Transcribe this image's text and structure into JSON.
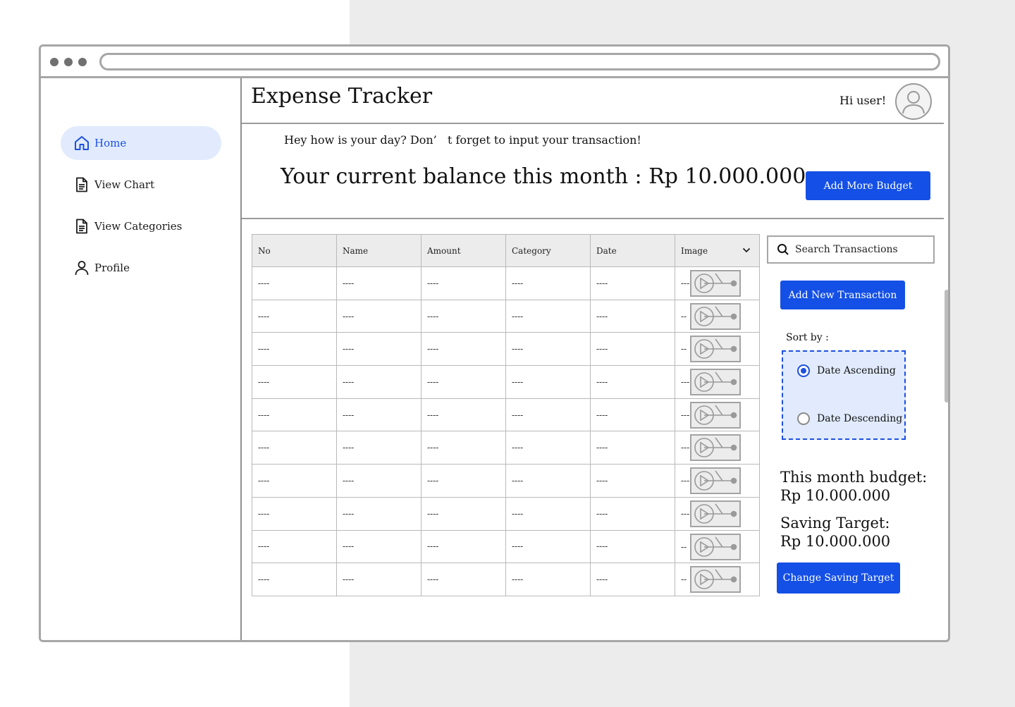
{
  "header": {
    "title": "Expense Tracker",
    "greeting": "Hi user!"
  },
  "sidebar": {
    "items": [
      {
        "label": "Home",
        "icon": "home-icon",
        "active": true
      },
      {
        "label": "View Chart",
        "icon": "document-icon"
      },
      {
        "label": "View Categories",
        "icon": "document-icon"
      },
      {
        "label": "Profile",
        "icon": "user-icon"
      }
    ]
  },
  "hero": {
    "reminder": "Hey how is your day? Don’   t forget to input your transaction!",
    "balance": "Your current balance this month : Rp 10.000.000",
    "add_budget_label": "Add More Budget"
  },
  "table": {
    "columns": [
      "No",
      "Name",
      "Amount",
      "Category",
      "Date",
      "Image"
    ],
    "rows": [
      [
        "----",
        "----",
        "----",
        "----",
        "----",
        "---"
      ],
      [
        "----",
        "----",
        "----",
        "----",
        "----",
        "--"
      ],
      [
        "----",
        "----",
        "----",
        "----",
        "----",
        "--"
      ],
      [
        "----",
        "----",
        "----",
        "----",
        "----",
        "---"
      ],
      [
        "----",
        "----",
        "----",
        "----",
        "----",
        "---"
      ],
      [
        "----",
        "----",
        "----",
        "----",
        "----",
        "---"
      ],
      [
        "----",
        "----",
        "----",
        "----",
        "----",
        "---"
      ],
      [
        "----",
        "----",
        "----",
        "----",
        "----",
        "---"
      ],
      [
        "----",
        "----",
        "----",
        "----",
        "----",
        "--"
      ],
      [
        "----",
        "----",
        "----",
        "----",
        "----",
        "--"
      ]
    ]
  },
  "search": {
    "placeholder": "Search Transactions"
  },
  "add_transaction_label": "Add New Transaction",
  "sort": {
    "label": "Sort by :",
    "options": [
      "Date Ascending",
      "Date Descending"
    ],
    "selected": "Date Ascending"
  },
  "budget": {
    "label": "This month budget:",
    "value": "Rp 10.000.000"
  },
  "saving": {
    "label": "Saving Target:",
    "value": "Rp 10.000.000",
    "button_label": "Change Saving Target"
  },
  "colors": {
    "accent": "#1450e6",
    "active_bg": "#e1ebfd",
    "page_bg": "#ececec"
  }
}
